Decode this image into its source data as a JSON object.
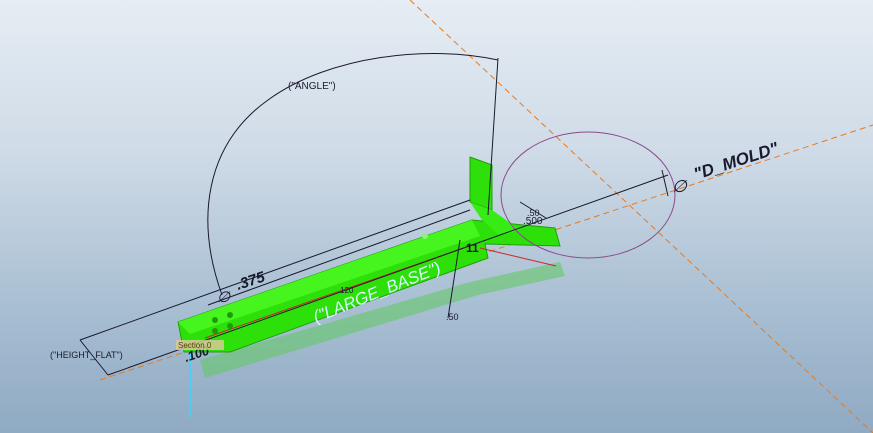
{
  "viewport": {
    "labels": {
      "angle": "(\"ANGLE\")",
      "d_mold": "\"D_MOLD\"",
      "diameter_symbol": "∅",
      "large_base": "(\"LARGE_BASE\")",
      "height_flat": "(\"HEIGHT_FLAT\")",
      "dim_375": ".375",
      "dim_500": ".500",
      "dim_50_top": ".50",
      "dim_50_bottom": ".50",
      "dim_100": ".100",
      "dim_120": "120",
      "dim_11": "11",
      "section": "Section 0"
    },
    "colors": {
      "background_top": "#e6edf4",
      "background_bottom": "#8faac3",
      "part_green": "#2ee00a",
      "part_shadow": "#5fc95e",
      "dimension_line": "#1a1a2e",
      "datum_orange": "#e87a1e",
      "circle_purple": "#8a4a8a",
      "param_cyan": "#d9f6ff",
      "axis_cyan": "#39d7ff"
    }
  }
}
